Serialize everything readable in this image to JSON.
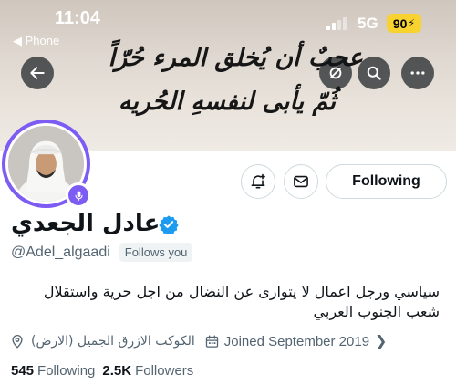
{
  "status_bar": {
    "time": "11:04",
    "back_app": "◀ Phone",
    "network": "5G",
    "battery": "90"
  },
  "banner": {
    "calligraphy_line1": "عجبٌ أن يُخلق المرء حُرّاً",
    "calligraphy_line2": "ثُمّ يأبى لنفسهِ الحُريه"
  },
  "icons": {
    "back": "arrow-left-icon",
    "hide": "eye-slash-icon",
    "search": "search-icon",
    "more": "more-horizontal-icon",
    "notify": "bell-plus-icon",
    "message": "envelope-icon",
    "verified": "verified-badge-icon",
    "location": "location-pin-icon",
    "calendar": "calendar-icon",
    "mic": "microphone-icon"
  },
  "colors": {
    "accent_purple": "#7d5cf3",
    "verified_blue": "#1d9bf0",
    "secondary_text": "#536471",
    "battery_yellow": "#f8d330"
  },
  "profile": {
    "display_name": "عادل الجعدي",
    "handle": "@Adel_algaadi",
    "follows_you": "Follows you",
    "bio": "سياسي ورجل اعمال لا يتوارى عن النضال من اجل حرية واستقلال شعب الجنوب العربي",
    "location": "الكوكب الازرق الجميل (الارض)",
    "joined": "Joined September 2019",
    "following_count": "545",
    "following_label": "Following",
    "followers_count": "2.5K",
    "followers_label": "Followers"
  },
  "actions": {
    "follow_button": "Following"
  }
}
